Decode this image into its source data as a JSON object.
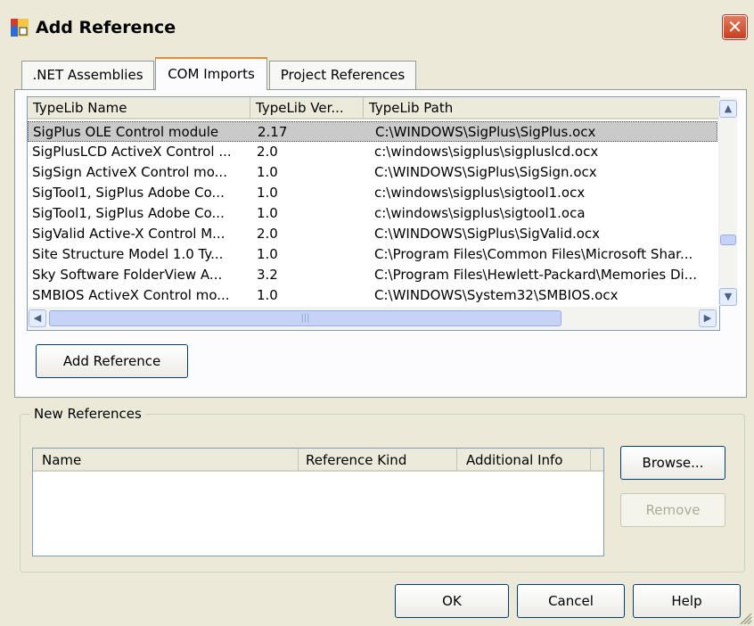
{
  "window": {
    "title": "Add Reference",
    "close_glyph": "✕"
  },
  "tabs": [
    {
      "label": ".NET Assemblies",
      "active": false
    },
    {
      "label": "COM Imports",
      "active": true
    },
    {
      "label": "Project References",
      "active": false
    }
  ],
  "com_list": {
    "columns": [
      "TypeLib Name",
      "TypeLib Ver...",
      "TypeLib Path"
    ],
    "rows": [
      {
        "name": "SigPlus OLE Control module",
        "version": "2.17",
        "path": "C:\\WINDOWS\\SigPlus\\SigPlus.ocx",
        "selected": true
      },
      {
        "name": "SigPlusLCD ActiveX Control ...",
        "version": "2.0",
        "path": "c:\\windows\\sigplus\\sigpluslcd.ocx"
      },
      {
        "name": "SigSign ActiveX Control mo...",
        "version": "1.0",
        "path": "C:\\WINDOWS\\SigPlus\\SigSign.ocx"
      },
      {
        "name": "SigTool1, SigPlus Adobe Co...",
        "version": "1.0",
        "path": "c:\\windows\\sigplus\\sigtool1.ocx"
      },
      {
        "name": "SigTool1, SigPlus Adobe Co...",
        "version": "1.0",
        "path": "c:\\windows\\sigplus\\sigtool1.oca"
      },
      {
        "name": "SigValid Active-X Control M...",
        "version": "2.0",
        "path": "C:\\WINDOWS\\SigPlus\\SigValid.ocx"
      },
      {
        "name": "Site Structure Model 1.0 Ty...",
        "version": "1.0",
        "path": "C:\\Program Files\\Common Files\\Microsoft Shar..."
      },
      {
        "name": "Sky Software FolderView A...",
        "version": "3.2",
        "path": "C:\\Program Files\\Hewlett-Packard\\Memories Di..."
      },
      {
        "name": "SMBIOS ActiveX Control mo...",
        "version": "1.0",
        "path": "C:\\WINDOWS\\System32\\SMBIOS.ocx"
      }
    ],
    "scroll": {
      "up_glyph": "▲",
      "down_glyph": "▼",
      "left_glyph": "◀",
      "right_glyph": "▶",
      "thumb_grip": "|||"
    }
  },
  "add_reference_button": "Add Reference",
  "new_references": {
    "group_label": "New References",
    "columns": [
      "Name",
      "Reference Kind",
      "Additional Info"
    ],
    "browse_button": "Browse...",
    "remove_button": "Remove"
  },
  "footer": {
    "ok": "OK",
    "cancel": "Cancel",
    "help": "Help"
  },
  "colors": {
    "face": "#ece9d8",
    "selection": "#cacaca",
    "close": "#c9401e",
    "active_tab_accent": "#e68b2c"
  }
}
